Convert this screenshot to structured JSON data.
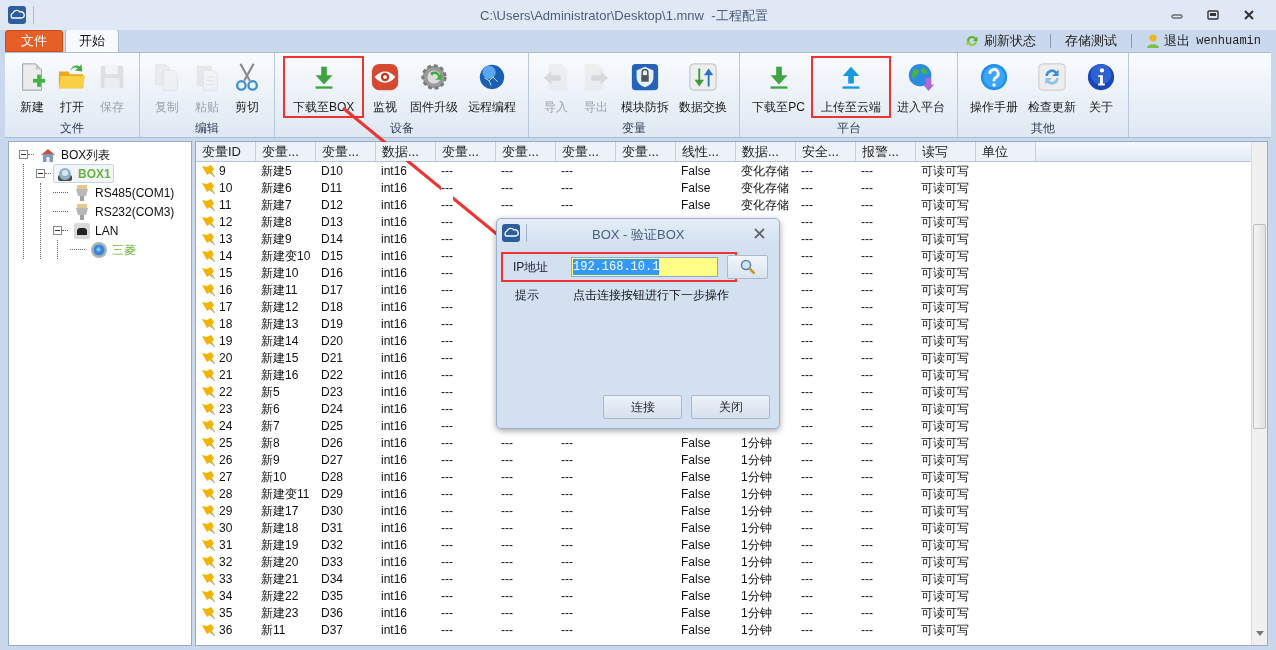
{
  "window": {
    "title": "C:\\Users\\Administrator\\Desktop\\1.mnw  -工程配置"
  },
  "tabs": [
    {
      "label": "文件",
      "kind": "file",
      "selected": false
    },
    {
      "label": "开始",
      "kind": "page",
      "selected": true
    }
  ],
  "quick_actions": [
    {
      "label": "刷新状态",
      "kind": "refresh"
    },
    {
      "label": "存储测试",
      "kind": "plain"
    },
    {
      "label": "退出",
      "kind": "user",
      "user": "wenhuamin"
    }
  ],
  "ribbon": [
    {
      "label": "文件",
      "buttons": [
        {
          "label": "新建",
          "kind": "new",
          "disabled": false,
          "highlighted": false
        },
        {
          "label": "打开",
          "kind": "open",
          "disabled": false,
          "highlighted": false
        },
        {
          "label": "保存",
          "kind": "save",
          "disabled": true,
          "highlighted": false
        }
      ]
    },
    {
      "label": "编辑",
      "buttons": [
        {
          "label": "复制",
          "kind": "copy",
          "disabled": true,
          "highlighted": false
        },
        {
          "label": "粘贴",
          "kind": "paste",
          "disabled": true,
          "highlighted": false
        },
        {
          "label": "剪切",
          "kind": "cut",
          "disabled": false,
          "highlighted": false
        }
      ]
    },
    {
      "label": "设备",
      "buttons": [
        {
          "label": "下载至BOX",
          "kind": "download",
          "disabled": false,
          "highlighted": true
        },
        {
          "label": "监视",
          "kind": "monitor",
          "disabled": false,
          "highlighted": false
        },
        {
          "label": "固件升级",
          "kind": "firmware",
          "disabled": false,
          "highlighted": false
        },
        {
          "label": "远程编程",
          "kind": "remote",
          "disabled": false,
          "highlighted": false
        }
      ]
    },
    {
      "label": "变量",
      "buttons": [
        {
          "label": "导入",
          "kind": "import",
          "disabled": true,
          "highlighted": false
        },
        {
          "label": "导出",
          "kind": "export",
          "disabled": true,
          "highlighted": false
        },
        {
          "label": "模块防拆",
          "kind": "guard",
          "disabled": false,
          "highlighted": false
        },
        {
          "label": "数据交换",
          "kind": "exchange",
          "disabled": false,
          "highlighted": false
        }
      ]
    },
    {
      "label": "平台",
      "buttons": [
        {
          "label": "下载至PC",
          "kind": "download",
          "disabled": false,
          "highlighted": false
        },
        {
          "label": "上传至云端",
          "kind": "upload",
          "disabled": false,
          "highlighted": true
        },
        {
          "label": "进入平台",
          "kind": "platform",
          "disabled": false,
          "highlighted": false
        }
      ]
    },
    {
      "label": "其他",
      "buttons": [
        {
          "label": "操作手册",
          "kind": "help",
          "disabled": false,
          "highlighted": false
        },
        {
          "label": "检查更新",
          "kind": "update",
          "disabled": false,
          "highlighted": false
        },
        {
          "label": "关于",
          "kind": "about",
          "disabled": false,
          "highlighted": false
        }
      ]
    }
  ],
  "tree": [
    {
      "label": "BOX列表",
      "kind": "home",
      "expanded": true,
      "selected": false,
      "online": false,
      "children": [
        {
          "label": "BOX1",
          "kind": "box",
          "expanded": true,
          "selected": true,
          "online": true,
          "children": [
            {
              "label": "RS485(COM1)",
              "kind": "serial",
              "selected": false,
              "online": false
            },
            {
              "label": "RS232(COM3)",
              "kind": "serial",
              "selected": false,
              "online": false
            },
            {
              "label": "LAN",
              "kind": "lan",
              "expanded": true,
              "selected": false,
              "online": false,
              "children": [
                {
                  "label": "三菱",
                  "kind": "plc",
                  "selected": false,
                  "online": true
                }
              ]
            }
          ]
        }
      ]
    }
  ],
  "table": {
    "columns": [
      "变量ID",
      "变量...",
      "变量...",
      "数据...",
      "变量...",
      "变量...",
      "变量...",
      "变量...",
      "线性...",
      "数据...",
      "安全...",
      "报警...",
      "读写",
      "单位"
    ],
    "rows": [
      [
        "9",
        "新建5",
        "D10",
        "int16",
        "---",
        "---",
        "---",
        null,
        "False",
        "变化存储",
        "---",
        "---",
        "可读可写",
        null
      ],
      [
        "10",
        "新建6",
        "D11",
        "int16",
        "---",
        "---",
        "---",
        null,
        "False",
        "变化存储",
        "---",
        "---",
        "可读可写",
        null
      ],
      [
        "11",
        "新建7",
        "D12",
        "int16",
        "---",
        "---",
        "---",
        null,
        "False",
        "变化存储",
        "---",
        "---",
        "可读可写",
        null
      ],
      [
        "12",
        "新建8",
        "D13",
        "int16",
        "---",
        null,
        null,
        null,
        null,
        null,
        "---",
        "---",
        "可读可写",
        null
      ],
      [
        "13",
        "新建9",
        "D14",
        "int16",
        "---",
        null,
        null,
        null,
        null,
        null,
        "---",
        "---",
        "可读可写",
        null
      ],
      [
        "14",
        "新建变10",
        "D15",
        "int16",
        "---",
        null,
        null,
        null,
        null,
        null,
        "---",
        "---",
        "可读可写",
        null
      ],
      [
        "15",
        "新建10",
        "D16",
        "int16",
        "---",
        null,
        null,
        null,
        null,
        null,
        "---",
        "---",
        "可读可写",
        null
      ],
      [
        "16",
        "新建11",
        "D17",
        "int16",
        "---",
        null,
        null,
        null,
        null,
        null,
        "---",
        "---",
        "可读可写",
        null
      ],
      [
        "17",
        "新建12",
        "D18",
        "int16",
        "---",
        null,
        null,
        null,
        null,
        null,
        "---",
        "---",
        "可读可写",
        null
      ],
      [
        "18",
        "新建13",
        "D19",
        "int16",
        "---",
        null,
        null,
        null,
        null,
        null,
        "---",
        "---",
        "可读可写",
        null
      ],
      [
        "19",
        "新建14",
        "D20",
        "int16",
        "---",
        null,
        null,
        null,
        null,
        null,
        "---",
        "---",
        "可读可写",
        null
      ],
      [
        "20",
        "新建15",
        "D21",
        "int16",
        "---",
        null,
        null,
        null,
        null,
        null,
        "---",
        "---",
        "可读可写",
        null
      ],
      [
        "21",
        "新建16",
        "D22",
        "int16",
        "---",
        null,
        null,
        null,
        null,
        null,
        "---",
        "---",
        "可读可写",
        null
      ],
      [
        "22",
        "新5",
        "D23",
        "int16",
        "---",
        null,
        null,
        null,
        null,
        null,
        "---",
        "---",
        "可读可写",
        null
      ],
      [
        "23",
        "新6",
        "D24",
        "int16",
        "---",
        null,
        null,
        null,
        null,
        null,
        "---",
        "---",
        "可读可写",
        null
      ],
      [
        "24",
        "新7",
        "D25",
        "int16",
        "---",
        null,
        null,
        null,
        null,
        null,
        "---",
        "---",
        "可读可写",
        null
      ],
      [
        "25",
        "新8",
        "D26",
        "int16",
        "---",
        "---",
        "---",
        null,
        "False",
        "1分钟",
        "---",
        "---",
        "可读可写",
        null
      ],
      [
        "26",
        "新9",
        "D27",
        "int16",
        "---",
        "---",
        "---",
        null,
        "False",
        "1分钟",
        "---",
        "---",
        "可读可写",
        null
      ],
      [
        "27",
        "新10",
        "D28",
        "int16",
        "---",
        "---",
        "---",
        null,
        "False",
        "1分钟",
        "---",
        "---",
        "可读可写",
        null
      ],
      [
        "28",
        "新建变11",
        "D29",
        "int16",
        "---",
        "---",
        "---",
        null,
        "False",
        "1分钟",
        "---",
        "---",
        "可读可写",
        null
      ],
      [
        "29",
        "新建17",
        "D30",
        "int16",
        "---",
        "---",
        "---",
        null,
        "False",
        "1分钟",
        "---",
        "---",
        "可读可写",
        null
      ],
      [
        "30",
        "新建18",
        "D31",
        "int16",
        "---",
        "---",
        "---",
        null,
        "False",
        "1分钟",
        "---",
        "---",
        "可读可写",
        null
      ],
      [
        "31",
        "新建19",
        "D32",
        "int16",
        "---",
        "---",
        "---",
        null,
        "False",
        "1分钟",
        "---",
        "---",
        "可读可写",
        null
      ],
      [
        "32",
        "新建20",
        "D33",
        "int16",
        "---",
        "---",
        "---",
        null,
        "False",
        "1分钟",
        "---",
        "---",
        "可读可写",
        null
      ],
      [
        "33",
        "新建21",
        "D34",
        "int16",
        "---",
        "---",
        "---",
        null,
        "False",
        "1分钟",
        "---",
        "---",
        "可读可写",
        null
      ],
      [
        "34",
        "新建22",
        "D35",
        "int16",
        "---",
        "---",
        "---",
        null,
        "False",
        "1分钟",
        "---",
        "---",
        "可读可写",
        null
      ],
      [
        "35",
        "新建23",
        "D36",
        "int16",
        "---",
        "---",
        "---",
        null,
        "False",
        "1分钟",
        "---",
        "---",
        "可读可写",
        null
      ],
      [
        "36",
        "新11",
        "D37",
        "int16",
        "---",
        "---",
        "---",
        null,
        "False",
        "1分钟",
        "---",
        "---",
        "可读可写",
        null
      ]
    ]
  },
  "dialog": {
    "title": "BOX - 验证BOX",
    "ip_label": "IP地址",
    "ip_value": "192.168.10.1",
    "text_selected": true,
    "ip_highlighted": true,
    "hint_label": "提示",
    "hint": "点击连接按钮进行下一步操作",
    "buttons": [
      "连接",
      "关闭"
    ]
  }
}
